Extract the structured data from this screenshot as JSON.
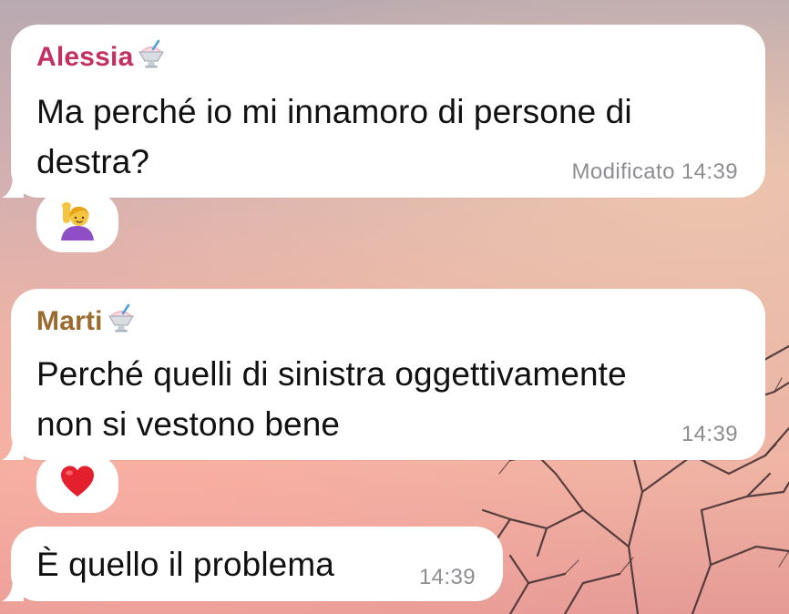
{
  "colors": {
    "alessia_name": "#c2315f",
    "marti_name": "#9a6a2e",
    "bubble": "#ffffff",
    "text": "#111111",
    "meta": "#8d8d92"
  },
  "messages": [
    {
      "sender": "Alessia",
      "sender_badge_icon": "shaved-ice-icon",
      "text_lines": [
        "Ma perché io mi innamoro di persone di",
        "destra?"
      ],
      "status": "Modificato 14:39",
      "reaction_icon": "person-raising-hand-icon"
    },
    {
      "sender": "Marti",
      "sender_badge_icon": "shaved-ice-icon",
      "text_lines": [
        "Perché quelli di sinistra oggettivamente",
        "non si vestono bene"
      ],
      "status": "14:39",
      "reaction_icon": "red-heart-icon"
    },
    {
      "sender": "",
      "text_lines": [
        "È quello il problema"
      ],
      "status": "14:39"
    }
  ]
}
